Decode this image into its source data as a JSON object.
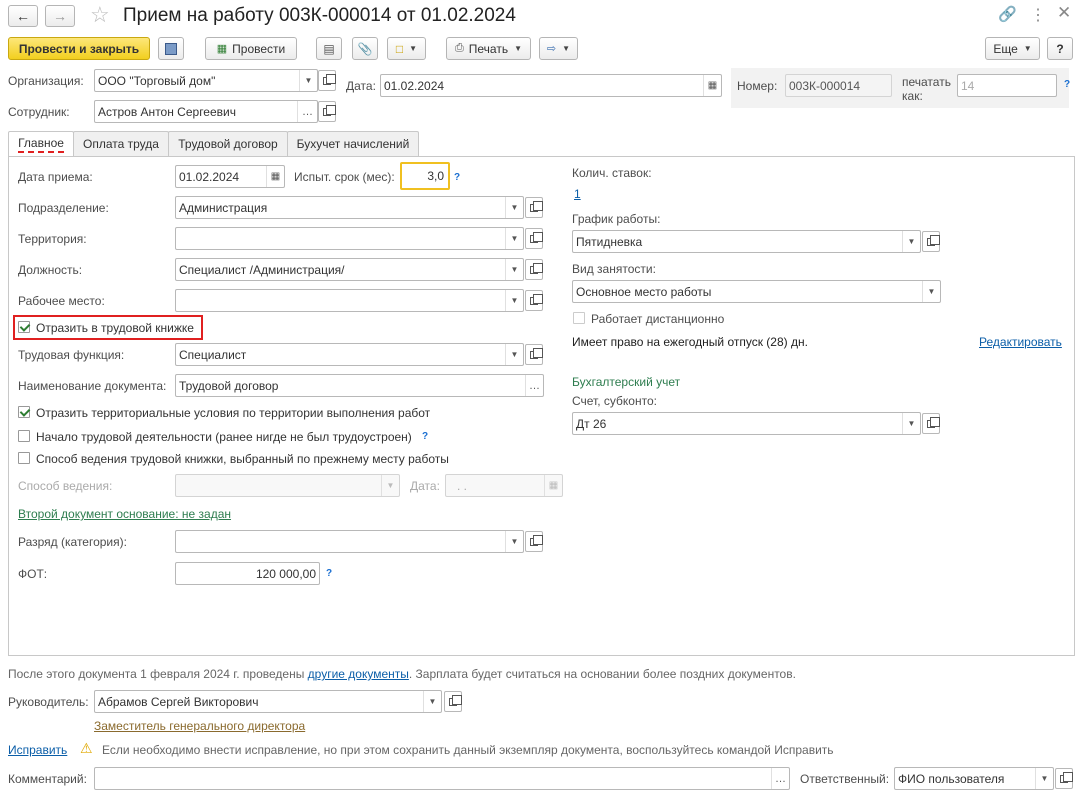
{
  "window": {
    "title": "Прием на работу 003К-000014 от 01.02.2024"
  },
  "toolbar": {
    "post_close": "Провести и закрыть",
    "post": "Провести",
    "print": "Печать",
    "more": "Еще",
    "help": "?"
  },
  "header": {
    "org_label": "Организация:",
    "org_value": "ООО \"Торговый дом\"",
    "date_label": "Дата:",
    "date_value": "01.02.2024",
    "number_label": "Номер:",
    "number_value": "003К-000014",
    "print_as_label": "печатать как:",
    "print_as_value": "14",
    "employee_label": "Сотрудник:",
    "employee_value": "Астров Антон Сергеевич"
  },
  "tabs": [
    "Главное",
    "Оплата труда",
    "Трудовой договор",
    "Бухучет начислений"
  ],
  "main": {
    "hire_date_label": "Дата приема:",
    "hire_date": "01.02.2024",
    "probation_label": "Испыт. срок (мес):",
    "probation_value": "3,0",
    "dept_label": "Подразделение:",
    "dept_value": "Администрация",
    "territory_label": "Территория:",
    "territory_value": "",
    "position_label": "Должность:",
    "position_value": "Специалист /Администрация/",
    "workplace_label": "Рабочее место:",
    "workplace_value": "",
    "reflect_book": "Отразить в трудовой книжке",
    "labor_func_label": "Трудовая функция:",
    "labor_func_value": "Специалист",
    "doc_name_label": "Наименование документа:",
    "doc_name_value": "Трудовой договор",
    "reflect_territory": "Отразить территориальные условия по территории выполнения работ",
    "first_job": "Начало трудовой деятельности (ранее нигде не был трудоустроен)",
    "book_method_prev": "Способ ведения трудовой книжки, выбранный по прежнему месту работы",
    "method_label": "Способ ведения:",
    "method_date_label": "Дата:",
    "method_date_value": ". .",
    "second_doc_link": "Второй документ основание: не задан",
    "grade_label": "Разряд (категория):",
    "grade_value": "",
    "fot_label": "ФОТ:",
    "fot_value": "120 000,00"
  },
  "right": {
    "rates_label": "Колич. ставок:",
    "rates_value": "1",
    "schedule_label": "График работы:",
    "schedule_value": "Пятидневка",
    "employment_label": "Вид занятости:",
    "employment_value": "Основное место работы",
    "remote_label": "Работает дистанционно",
    "vacation_text": "Имеет право на ежегодный отпуск (28) дн.",
    "edit_link": "Редактировать",
    "accounting_title": "Бухгалтерский учет",
    "account_label": "Счет, субконто:",
    "account_value": "Дт 26"
  },
  "footer": {
    "info_prefix": "После этого документа 1 февраля 2024 г. проведены ",
    "info_link": "другие документы",
    "info_suffix": ". Зарплата будет считаться на основании более поздних документов.",
    "manager_label": "Руководитель:",
    "manager_value": "Абрамов Сергей Викторович",
    "manager_position": "Заместитель генерального директора",
    "fix_link": "Исправить",
    "fix_text": "Если необходимо внести исправление, но при этом сохранить данный экземпляр документа, воспользуйтесь командой Исправить",
    "comment_label": "Комментарий:",
    "comment_value": "",
    "responsible_label": "Ответственный:",
    "responsible_value": "ФИО пользователя"
  },
  "colors": {
    "accent_yellow": "#f5d533",
    "focus_border": "#f0c020",
    "link": "#0b5ea8",
    "green_link": "#2e7d4f",
    "highlight_red": "#e02020"
  }
}
